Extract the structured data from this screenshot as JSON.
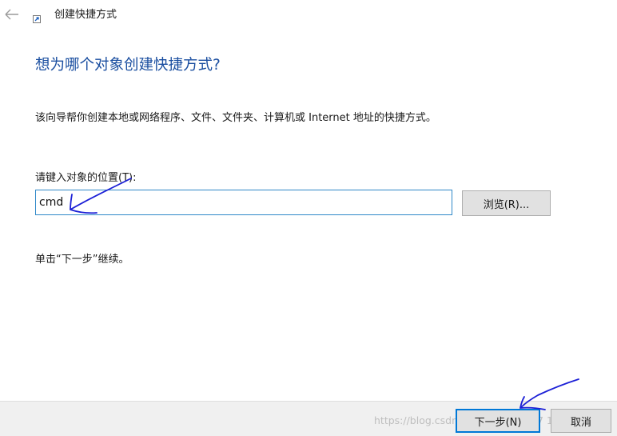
{
  "window": {
    "title": "创建快捷方式",
    "back_icon": "arrow-left-icon",
    "app_icon": "shortcut-icon"
  },
  "wizard": {
    "heading": "想为哪个对象创建快捷方式?",
    "description": "该向导帮你创建本地或网络程序、文件、文件夹、计算机或 Internet 地址的快捷方式。",
    "location_label": "请键入对象的位置(T):",
    "location_value": "cmd",
    "browse_label": "浏览(R)...",
    "continue_hint": "单击“下一步”继续。"
  },
  "footer": {
    "next_label": "下一步(N)",
    "cancel_label": "取消"
  },
  "overlay": {
    "watermark": "https://blog.csdn.net/weixin_4627  19"
  },
  "colors": {
    "heading": "#1a4ea0",
    "input_focus_border": "#2f88c8",
    "default_button_border": "#0078d7",
    "annotation_ink": "#1b1fd6"
  }
}
